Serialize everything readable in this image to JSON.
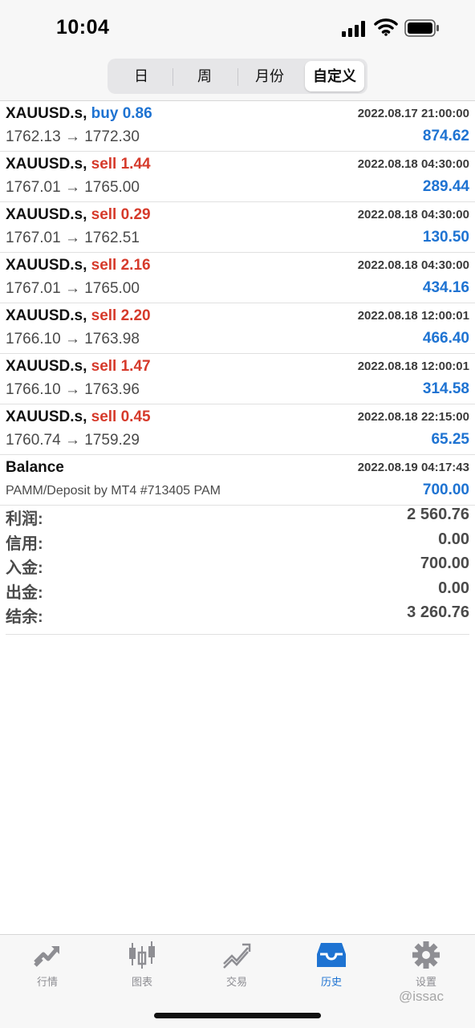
{
  "status_bar": {
    "time": "10:04"
  },
  "period_tabs": [
    {
      "label": "日",
      "active": false
    },
    {
      "label": "周",
      "active": false
    },
    {
      "label": "月份",
      "active": false
    },
    {
      "label": "自定义",
      "active": true
    }
  ],
  "trades": [
    {
      "symbol": "XAUUSD.s,",
      "type": "buy",
      "volume_text": "buy 0.86",
      "time": "2022.08.17 21:00:00",
      "prices": "1762.13 → 1772.30",
      "profit": "874.62"
    },
    {
      "symbol": "XAUUSD.s,",
      "type": "sell",
      "volume_text": "sell 1.44",
      "time": "2022.08.18 04:30:00",
      "prices": "1767.01 → 1765.00",
      "profit": "289.44"
    },
    {
      "symbol": "XAUUSD.s,",
      "type": "sell",
      "volume_text": "sell 0.29",
      "time": "2022.08.18 04:30:00",
      "prices": "1767.01 → 1762.51",
      "profit": "130.50"
    },
    {
      "symbol": "XAUUSD.s,",
      "type": "sell",
      "volume_text": "sell 2.16",
      "time": "2022.08.18 04:30:00",
      "prices": "1767.01 → 1765.00",
      "profit": "434.16"
    },
    {
      "symbol": "XAUUSD.s,",
      "type": "sell",
      "volume_text": "sell 2.20",
      "time": "2022.08.18 12:00:01",
      "prices": "1766.10 → 1763.98",
      "profit": "466.40"
    },
    {
      "symbol": "XAUUSD.s,",
      "type": "sell",
      "volume_text": "sell 1.47",
      "time": "2022.08.18 12:00:01",
      "prices": "1766.10 → 1763.96",
      "profit": "314.58"
    },
    {
      "symbol": "XAUUSD.s,",
      "type": "sell",
      "volume_text": "sell 0.45",
      "time": "2022.08.18 22:15:00",
      "prices": "1760.74 → 1759.29",
      "profit": "65.25"
    }
  ],
  "balance": {
    "title": "Balance",
    "time": "2022.08.19 04:17:43",
    "comment": "PAMM/Deposit by MT4 #713405 PAM",
    "amount": "700.00"
  },
  "summary": [
    {
      "label": "利润:",
      "value": "2 560.76"
    },
    {
      "label": "信用:",
      "value": "0.00"
    },
    {
      "label": "入金:",
      "value": "700.00"
    },
    {
      "label": "出金:",
      "value": "0.00"
    },
    {
      "label": "结余:",
      "value": "3 260.76"
    }
  ],
  "tabbar": [
    {
      "label": "行情",
      "icon": "quotes-icon",
      "active": false
    },
    {
      "label": "图表",
      "icon": "chart-candles-icon",
      "active": false
    },
    {
      "label": "交易",
      "icon": "trade-icon",
      "active": false
    },
    {
      "label": "历史",
      "icon": "history-inbox-icon",
      "active": true
    },
    {
      "label": "设置",
      "icon": "gear-icon",
      "active": false
    }
  ],
  "watermark": "@issac",
  "colors": {
    "blue": "#1e73d2",
    "red": "#d63a2b",
    "tab_inactive": "#8e8e93"
  }
}
